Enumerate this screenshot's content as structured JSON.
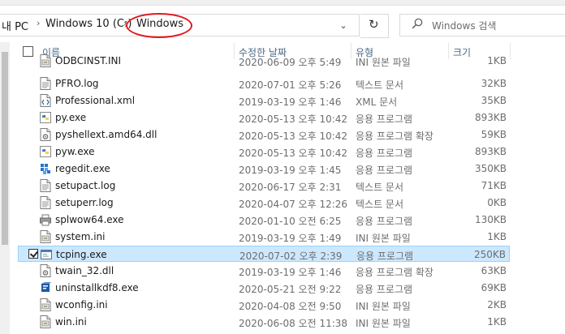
{
  "address": {
    "crumbs": [
      "내 PC",
      "Windows 10 (C:)",
      "Windows"
    ],
    "separator": "›",
    "dropdown": "⌄",
    "refresh": "↻"
  },
  "search": {
    "placeholder": "Windows 검색"
  },
  "columns": {
    "name": "이름",
    "date": "수정한 날짜",
    "type": "유형",
    "size": "크기"
  },
  "files": [
    {
      "name": "ODBCINST.INI",
      "date": "2020-06-09 오후 5:49",
      "type": "INI 원본 파일",
      "size": "1KB",
      "icon": "ini-file-icon"
    },
    {
      "name": "PFRO.log",
      "date": "2020-07-01 오후 5:26",
      "type": "텍스트 문서",
      "size": "32KB",
      "icon": "text-file-icon"
    },
    {
      "name": "Professional.xml",
      "date": "2019-03-19 오후 1:46",
      "type": "XML 문서",
      "size": "35KB",
      "icon": "xml-file-icon"
    },
    {
      "name": "py.exe",
      "date": "2020-05-13 오후 10:42",
      "type": "응용 프로그램",
      "size": "893KB",
      "icon": "python-icon"
    },
    {
      "name": "pyshellext.amd64.dll",
      "date": "2020-05-13 오후 10:42",
      "type": "응용 프로그램 확장",
      "size": "59KB",
      "icon": "dll-file-icon"
    },
    {
      "name": "pyw.exe",
      "date": "2020-05-13 오후 10:42",
      "type": "응용 프로그램",
      "size": "893KB",
      "icon": "python-icon"
    },
    {
      "name": "regedit.exe",
      "date": "2019-03-19 오후 1:45",
      "type": "응용 프로그램",
      "size": "350KB",
      "icon": "registry-editor-icon"
    },
    {
      "name": "setupact.log",
      "date": "2020-06-17 오후 2:31",
      "type": "텍스트 문서",
      "size": "71KB",
      "icon": "text-file-icon"
    },
    {
      "name": "setuperr.log",
      "date": "2020-04-07 오후 12:26",
      "type": "텍스트 문서",
      "size": "0KB",
      "icon": "text-file-icon"
    },
    {
      "name": "splwow64.exe",
      "date": "2020-01-10 오전 6:25",
      "type": "응용 프로그램",
      "size": "130KB",
      "icon": "printer-icon"
    },
    {
      "name": "system.ini",
      "date": "2019-03-19 오후 1:49",
      "type": "INI 원본 파일",
      "size": "1KB",
      "icon": "ini-file-icon"
    },
    {
      "name": "tcping.exe",
      "date": "2020-07-02 오후 2:39",
      "type": "응용 프로그램",
      "size": "250KB",
      "icon": "application-icon",
      "selected": true
    },
    {
      "name": "twain_32.dll",
      "date": "2019-03-19 오후 1:46",
      "type": "응용 프로그램 확장",
      "size": "63KB",
      "icon": "dll-file-icon"
    },
    {
      "name": "uninstallkdf8.exe",
      "date": "2020-05-21 오전 9:22",
      "type": "응용 프로그램",
      "size": "69KB",
      "icon": "uninstaller-icon"
    },
    {
      "name": "wconfig.ini",
      "date": "2020-04-08 오전 9:50",
      "type": "INI 원본 파일",
      "size": "2KB",
      "icon": "ini-file-icon"
    },
    {
      "name": "win.ini",
      "date": "2020-06-08 오전 11:38",
      "type": "INI 원본 파일",
      "size": "1KB",
      "icon": "ini-file-icon"
    }
  ],
  "colors": {
    "selection_bg": "#cce8ff",
    "selection_border": "#99d1ff",
    "highlight_ellipse": "#e0181d",
    "header_text": "#4a6984"
  }
}
